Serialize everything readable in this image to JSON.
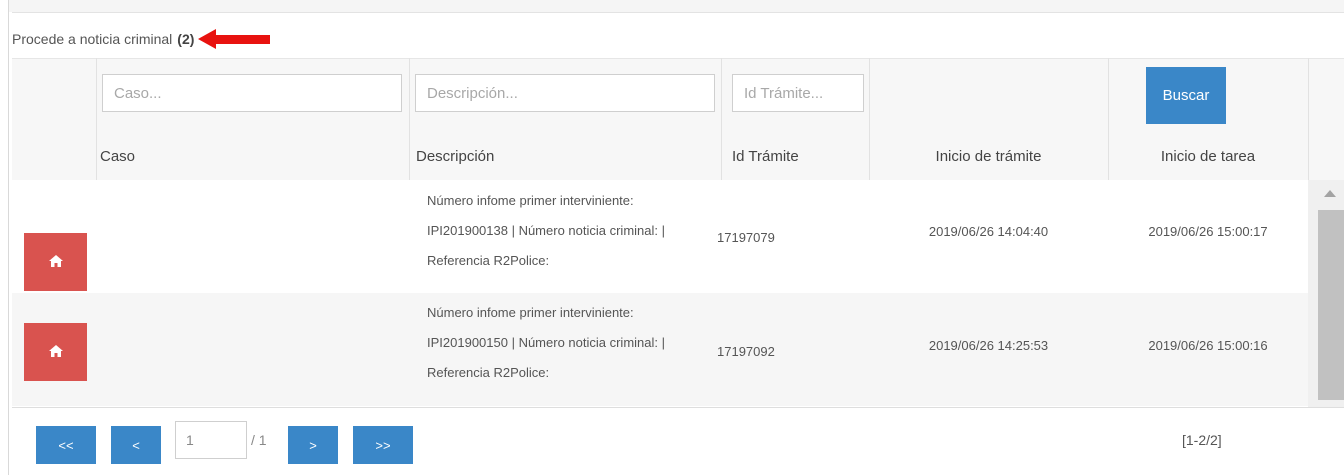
{
  "panel": {
    "title": "Procede a noticia criminal",
    "count": "(2)"
  },
  "filters": {
    "caso_placeholder": "Caso...",
    "descripcion_placeholder": "Descripción...",
    "id_tramite_placeholder": "Id Trámite...",
    "search_label": "Buscar"
  },
  "columns": {
    "caso": "Caso",
    "descripcion": "Descripción",
    "id_tramite": "Id Trámite",
    "inicio_tramite": "Inicio de trámite",
    "inicio_tarea": "Inicio de tarea"
  },
  "rows": [
    {
      "icon": "home-icon",
      "caso": "",
      "descripcion": [
        "Número infome primer interviniente:",
        "IPI201900138 | Número noticia criminal: |",
        "Referencia R2Police:"
      ],
      "id_tramite": "17197079",
      "inicio_tramite": "2019/06/26 14:04:40",
      "inicio_tarea": "2019/06/26 15:00:17"
    },
    {
      "icon": "home-icon",
      "caso": "",
      "descripcion": [
        "Número infome primer interviniente:",
        "IPI201900150 | Número noticia criminal: |",
        "Referencia R2Police:"
      ],
      "id_tramite": "17197092",
      "inicio_tramite": "2019/06/26 14:25:53",
      "inicio_tarea": "2019/06/26 15:00:16"
    }
  ],
  "pagination": {
    "first": "<<",
    "prev": "<",
    "page": "1",
    "total": "/ 1",
    "next": ">",
    "last": ">>",
    "range": "[1-2/2]"
  },
  "colors": {
    "primary": "#3a87c8",
    "danger": "#d9534f",
    "arrow": "#e8120f"
  }
}
